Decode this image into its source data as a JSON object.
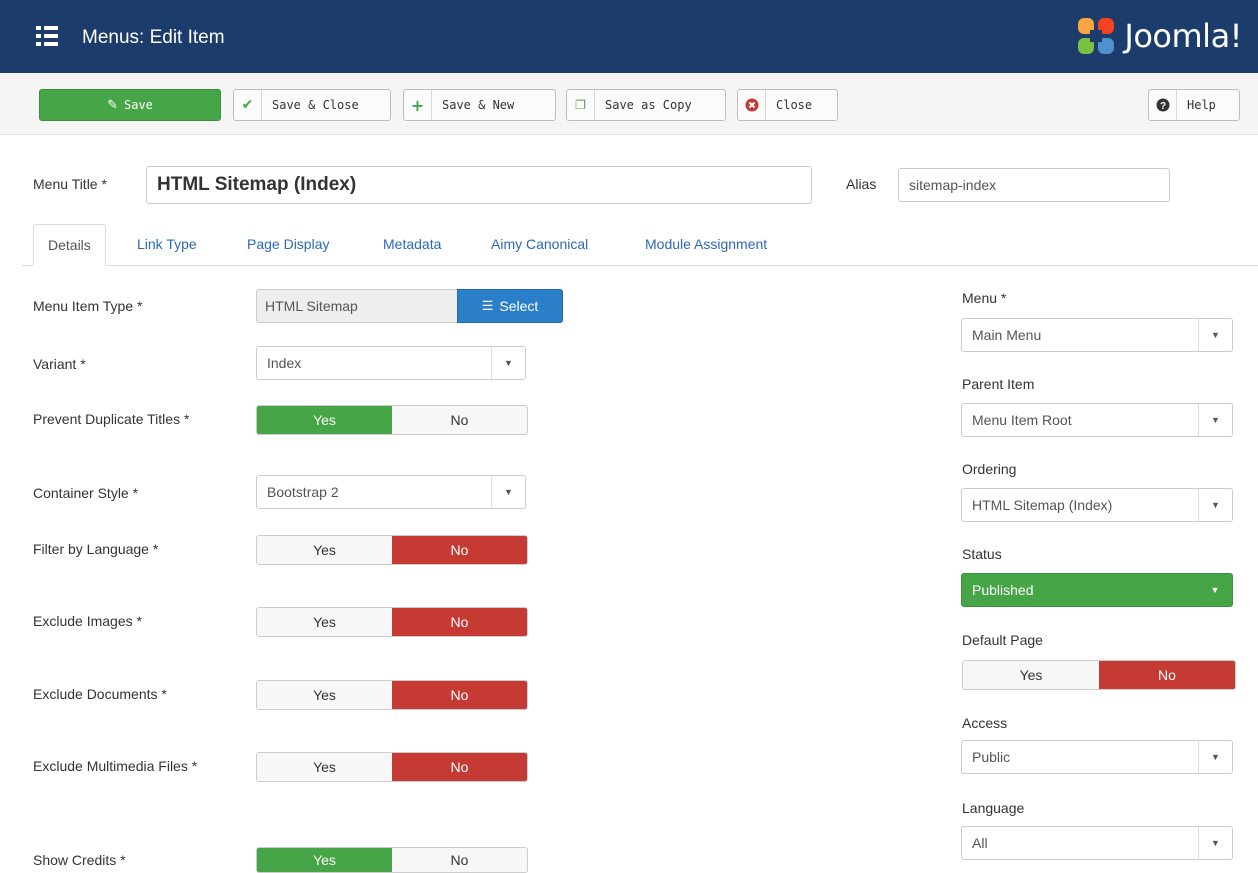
{
  "header": {
    "title": "Menus: Edit Item",
    "logo_text": "Joomla!",
    "colors": {
      "bar": "#1c3d6b"
    }
  },
  "toolbar": {
    "save": {
      "label": "Save",
      "icon": "edit-icon"
    },
    "save_close": {
      "label": "Save & Close",
      "icon": "check-icon"
    },
    "save_new": {
      "label": "Save & New",
      "icon": "plus-icon"
    },
    "save_copy": {
      "label": "Save as Copy",
      "icon": "copy-icon"
    },
    "close": {
      "label": "Close",
      "icon": "cancel-circle-icon"
    },
    "help": {
      "label": "Help",
      "icon": "question-circle-icon"
    }
  },
  "title_row": {
    "menu_title_label": "Menu Title *",
    "menu_title_value": "HTML Sitemap (Index)",
    "alias_label": "Alias",
    "alias_value": "sitemap-index"
  },
  "tabs": [
    {
      "label": "Details",
      "active": true
    },
    {
      "label": "Link Type",
      "active": false
    },
    {
      "label": "Page Display",
      "active": false
    },
    {
      "label": "Metadata",
      "active": false
    },
    {
      "label": "Aimy Canonical",
      "active": false
    },
    {
      "label": "Module Assignment",
      "active": false
    }
  ],
  "left_fields": {
    "menu_item_type": {
      "label": "Menu Item Type *",
      "value": "HTML Sitemap",
      "button": "Select"
    },
    "variant": {
      "label": "Variant *",
      "value": "Index"
    },
    "prevent_duplicate_titles": {
      "label": "Prevent Duplicate Titles *",
      "yes": "Yes",
      "no": "No",
      "selected": "yes"
    },
    "container_style": {
      "label": "Container Style *",
      "value": "Bootstrap 2"
    },
    "filter_by_language": {
      "label": "Filter by Language *",
      "yes": "Yes",
      "no": "No",
      "selected": "no"
    },
    "exclude_images": {
      "label": "Exclude Images *",
      "yes": "Yes",
      "no": "No",
      "selected": "no"
    },
    "exclude_documents": {
      "label": "Exclude Documents *",
      "yes": "Yes",
      "no": "No",
      "selected": "no"
    },
    "exclude_multimedia": {
      "label": "Exclude Multimedia Files *",
      "yes": "Yes",
      "no": "No",
      "selected": "no"
    },
    "show_credits": {
      "label": "Show Credits *",
      "yes": "Yes",
      "no": "No",
      "selected": "yes"
    }
  },
  "right_fields": {
    "menu": {
      "label": "Menu *",
      "value": "Main Menu"
    },
    "parent_item": {
      "label": "Parent Item",
      "value": "Menu Item Root"
    },
    "ordering": {
      "label": "Ordering",
      "value": "HTML Sitemap (Index)"
    },
    "status": {
      "label": "Status",
      "value": "Published"
    },
    "default_page": {
      "label": "Default Page",
      "yes": "Yes",
      "no": "No",
      "selected": "no"
    },
    "access": {
      "label": "Access",
      "value": "Public"
    },
    "language": {
      "label": "Language",
      "value": "All"
    }
  },
  "colors": {
    "success": "#46a546",
    "danger": "#c53a32",
    "primary": "#2a7fc8",
    "link": "#2a69b8"
  }
}
